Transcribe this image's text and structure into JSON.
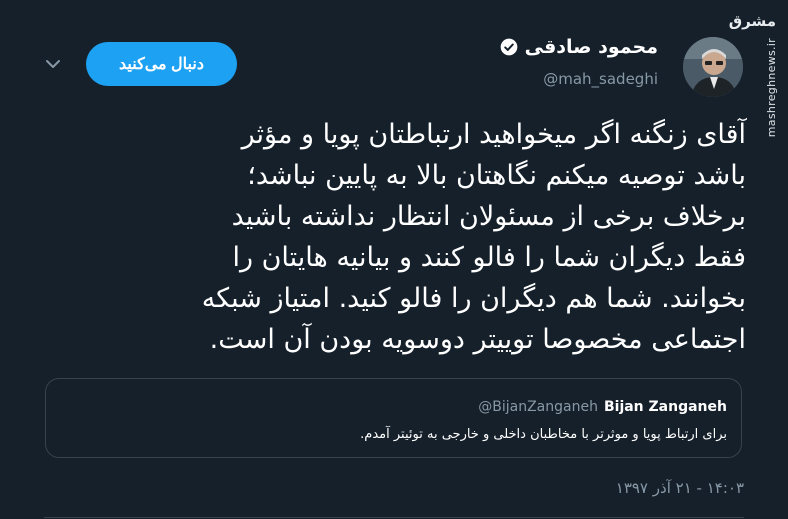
{
  "watermark": {
    "logo_text": "مشرق",
    "site": "mashreghnews.ir"
  },
  "author": {
    "display_name": "محمود صادقی",
    "handle": "@mah_sadeghi",
    "verified": true
  },
  "follow_button": {
    "label": "دنبال می‌کنید"
  },
  "tweet": {
    "lines": [
      "آقای زنگنه اگر میخواهید ارتباطتان پویا و مؤثر",
      "باشد توصیه میکنم نگاهتان بالا به پایین نباشد؛",
      "برخلاف برخی از مسئولان انتظار نداشته باشید",
      "فقط دیگران شما را فالو کنند و بیانیه هایتان را",
      "بخوانند. شما هم دیگران را فالو کنید. امتیاز شبکه",
      "اجتماعی مخصوصا توییتر دوسویه بودن آن است."
    ],
    "timestamp": "۱۴:۰۳ - ۲۱ آذر ۱۳۹۷"
  },
  "quoted_tweet": {
    "name": "Bijan Zanganeh",
    "handle": "@BijanZanganeh",
    "text": "برای ارتباط پویا و موثرتر با مخاطبان داخلی و خارجی به توئیتر آمدم."
  },
  "colors": {
    "background": "#15202b",
    "accent": "#1da1f2",
    "muted": "#8899a6",
    "border": "#38444d"
  },
  "icons": {
    "verified": "verified-badge-icon",
    "dropdown": "chevron-down-icon"
  }
}
